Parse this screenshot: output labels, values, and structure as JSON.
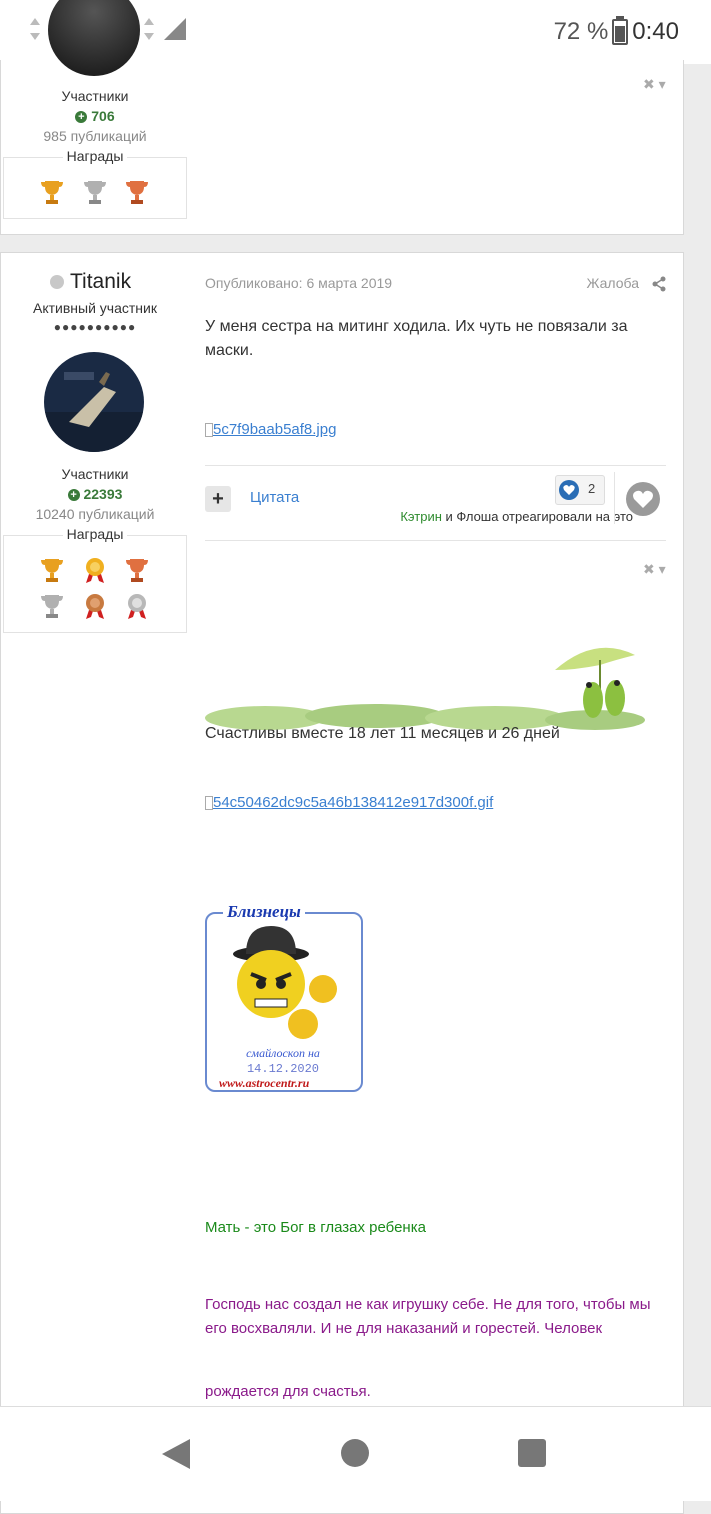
{
  "status_bar": {
    "battery_percent": "72 %",
    "time": "0:40",
    "icons": [
      "data-arrows-icon",
      "wifi-icon",
      "data-arrows-icon",
      "signal-x-icon",
      "data-arrows-icon",
      "signal-icon"
    ]
  },
  "prev_post": {
    "role": "Участники",
    "reputation": "706",
    "posts_count": "985 публикаций",
    "awards_title": "Награды",
    "awards": [
      "gold-trophy-icon",
      "silver-trophy-icon",
      "bronze-trophy-icon"
    ]
  },
  "post": {
    "author": {
      "name": "Titanik",
      "title": "Активный участник",
      "rank_pips": "●●●●●●●●●●",
      "role": "Участники",
      "reputation": "22393",
      "posts_count": "10240 публикаций",
      "awards_title": "Награды",
      "awards": [
        "gold-trophy-icon",
        "gold-medal-icon",
        "bronze-trophy-icon",
        "silver-trophy-icon",
        "bronze-medal-icon",
        "silver-medal-icon"
      ]
    },
    "published": "Опубликовано: 6 марта 2019",
    "report_label": "Жалоба",
    "body_text": "У меня сестра на митинг ходила. Их чуть не повязали за маски.",
    "image_link": "5c7f9baab5af8.jpg",
    "quote_label": "Цитата",
    "reaction_count": "2",
    "reacted_user_1": "Кэтрин",
    "reacted_connector": " и ",
    "reacted_user_2": "Флоша",
    "reacted_suffix": " отреагировали на это",
    "menu_glyph": "✖ ▾"
  },
  "signature": {
    "together_text": "Счастливы вместе 18 лет 11 месяцев и 26 дней",
    "gif_link": "54c50462dc9c5a46b138412e917d300f.gif",
    "horoscope_title": "Близнецы",
    "horoscope_caption": "смайлоскоп на",
    "horoscope_date": "14.12.2020",
    "horoscope_site": "www.astrocentr.ru",
    "quote_green": "Мать - это Бог в глазах ребенка",
    "quote_purple": "Господь нас создал не как игрушку себе. Не для того, чтобы мы его восхваляли. И не для наказаний и горестей. Человек",
    "quote_purple_end": "рождается для счастья.",
    "colors": {
      "green": "#1a8a1a",
      "purple": "#8a1a8a",
      "link": "#3a7fd0"
    }
  }
}
